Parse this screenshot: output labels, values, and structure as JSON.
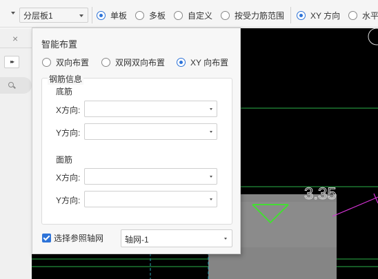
{
  "toolbar": {
    "layer_select": "分层板1",
    "options": [
      {
        "label": "单板",
        "checked": true
      },
      {
        "label": "多板",
        "checked": false
      },
      {
        "label": "自定义",
        "checked": false
      },
      {
        "label": "按受力筋范围",
        "checked": false
      }
    ],
    "direction_options": [
      {
        "label": "XY 方向",
        "checked": true
      },
      {
        "label": "水平",
        "checked": false
      }
    ]
  },
  "side_panel": {
    "close_glyph": "×",
    "expand_glyph": "▸▸"
  },
  "dialog": {
    "title": "智能布置",
    "modes": [
      {
        "label": "双向布置",
        "checked": false
      },
      {
        "label": "双网双向布置",
        "checked": false
      },
      {
        "label": "XY 向布置",
        "checked": true
      }
    ],
    "group_title": "钢筋信息",
    "bottom_title": "底筋",
    "top_title": "面筋",
    "x_label": "X方向:",
    "y_label": "Y方向:",
    "fields": {
      "bottom_x": "",
      "bottom_y": "",
      "top_x": "",
      "top_y": ""
    },
    "use_grid_label": "选择参照轴网",
    "use_grid_checked": true,
    "grid_select": "轴网-1"
  },
  "canvas": {
    "dimension_label": "3.35",
    "background_color": "#000000",
    "line_color": "#33cc33",
    "accent_line_color": "#d633d6",
    "slab_color": "#858585"
  },
  "icons": [
    "caret-down-icon",
    "radio-icon",
    "close-icon",
    "expand-icon",
    "search-icon",
    "checkbox-icon"
  ],
  "colors": {
    "accent": "#2d73d8"
  }
}
